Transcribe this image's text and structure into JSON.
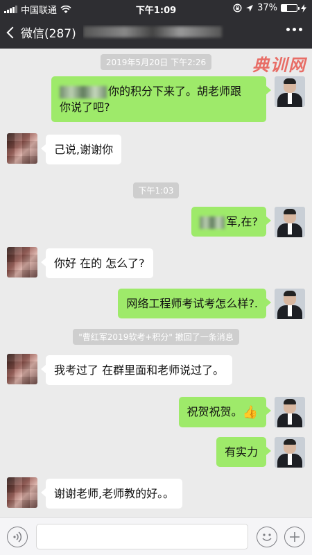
{
  "status_bar": {
    "carrier": "中国联通",
    "time": "下午1:09",
    "battery": "37%",
    "battery_level": 0.37
  },
  "nav": {
    "back_label": "微信(287)",
    "title": ""
  },
  "watermark": "典训网",
  "messages": [
    {
      "type": "time",
      "text": "2019年5月20日 下午2:26"
    },
    {
      "type": "bubble",
      "from": "me",
      "line1": "你的积分下来了。胡老师跟",
      "line2": "你说了吧?"
    },
    {
      "type": "bubble",
      "from": "them",
      "text": "己说,谢谢你"
    },
    {
      "type": "time",
      "text": "下午1:03"
    },
    {
      "type": "bubble",
      "from": "me",
      "text": "军,在?"
    },
    {
      "type": "bubble",
      "from": "them",
      "text": "你好 在的  怎么了?"
    },
    {
      "type": "bubble",
      "from": "me",
      "text": "网络工程师考试考怎么样?."
    },
    {
      "type": "system",
      "text": "\"曹红军2019软考+积分\" 撤回了一条消息"
    },
    {
      "type": "bubble",
      "from": "them",
      "text": "我考过了  在群里面和老师说过了。"
    },
    {
      "type": "bubble",
      "from": "me",
      "text": "祝贺祝贺。",
      "emoji": "👍"
    },
    {
      "type": "bubble",
      "from": "me",
      "text": "有实力"
    },
    {
      "type": "bubble",
      "from": "them",
      "text": "谢谢老师,老师教的好。。"
    }
  ],
  "icons": {
    "voice": "voice-icon",
    "emoji": "emoji-icon",
    "plus": "plus-icon",
    "more": "more-icon",
    "back": "chevron-left-icon"
  }
}
